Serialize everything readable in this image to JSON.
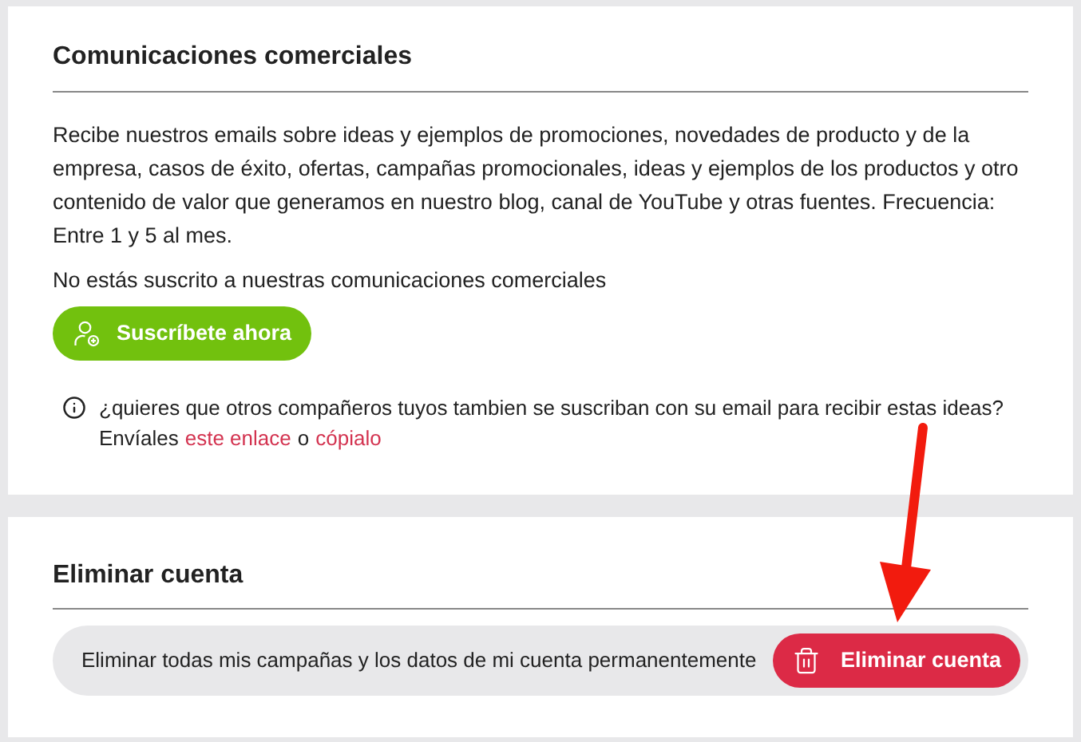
{
  "commercial": {
    "title": "Comunicaciones comerciales",
    "description": "Recibe nuestros emails sobre ideas y ejemplos de promociones, novedades de producto y de la empresa, casos de éxito, ofertas, campañas promocionales, ideas y ejemplos de los productos y otro contenido de valor que generamos en nuestro blog, canal de YouTube y otras fuentes. Frecuencia: Entre 1 y 5 al mes.",
    "status": "No estás suscrito a nuestras comunicaciones comerciales",
    "subscribe_button": "Suscríbete ahora",
    "info": {
      "text": "¿quieres que otros compañeros tuyos tambien se suscriban con su email para recibir estas ideas?",
      "prefix": "Envíales",
      "link_1": "este enlace",
      "connector": "o",
      "link_2": "cópialo"
    }
  },
  "delete_account": {
    "title": "Eliminar cuenta",
    "description": "Eliminar todas mis campañas y los datos de mi cuenta permanentemente",
    "button": "Eliminar cuenta"
  }
}
